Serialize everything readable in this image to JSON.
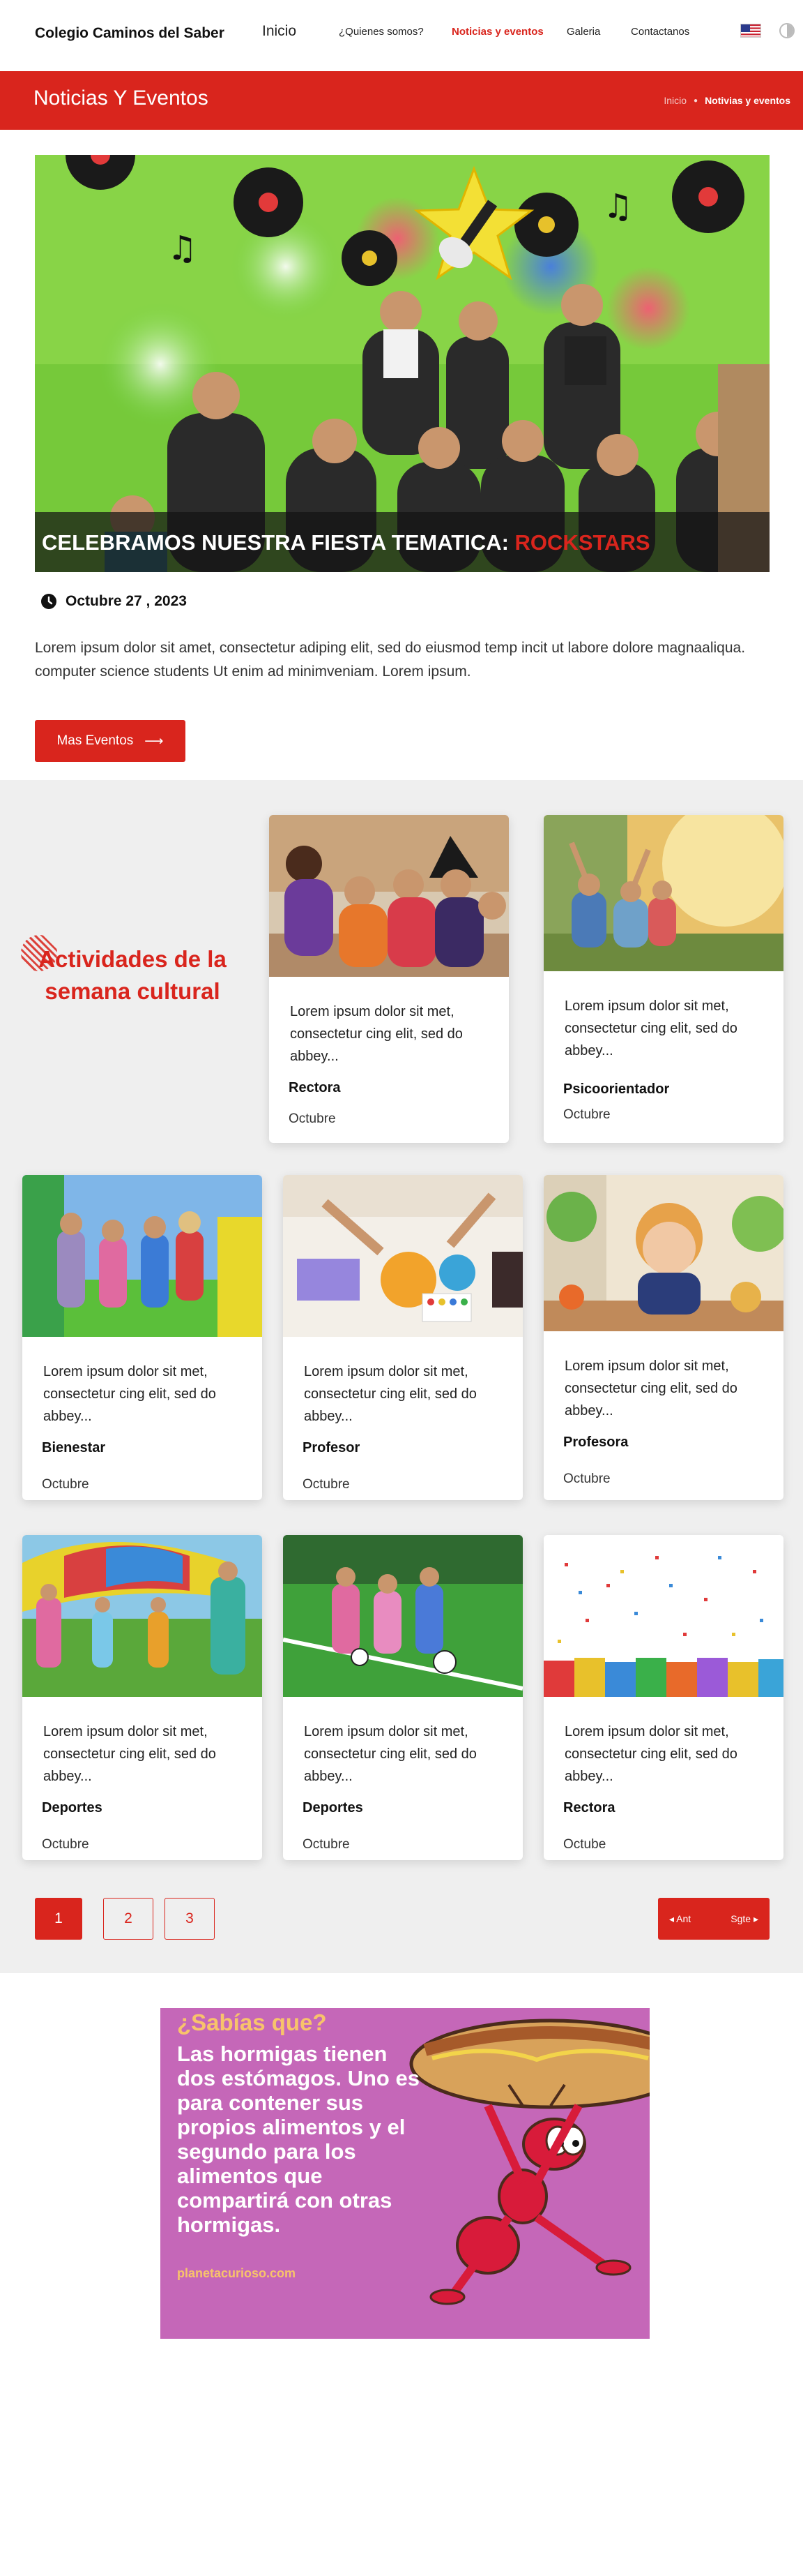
{
  "header": {
    "logo": "Colegio Caminos del Saber",
    "nav": {
      "home": "Inicio",
      "about": "¿Quienes somos?",
      "news": "Noticias y eventos",
      "gallery": "Galeria",
      "contact": "Contactanos"
    }
  },
  "banner": {
    "title": "Noticias Y Eventos",
    "breadcrumb_home": "Inicio",
    "breadcrumb_current": "Notivias y eventos"
  },
  "hero": {
    "caption_main": "CELEBRAMOS NUESTRA FIESTA TEMATICA: ",
    "caption_highlight": "ROCKSTARS"
  },
  "post": {
    "date": "Octubre 27 , 2023",
    "intro": "Lorem ipsum dolor sit amet, consectetur adiping elit, sed do eiusmod temp incit ut labore dolore magnaaliqua. computer science students Ut enim ad minimveniam. Lorem ipsum.",
    "more_label": "Mas Eventos"
  },
  "activities": {
    "title": "Actividades de la semana cultural",
    "cards": [
      {
        "text": "Lorem ipsum dolor sit met, consectetur cing elit, sed do abbey...",
        "role": "Rectora",
        "date": "Octubre"
      },
      {
        "text": "Lorem ipsum dolor sit met, consectetur cing elit, sed do abbey...",
        "role": "Psicoorientador",
        "date": "Octubre"
      },
      {
        "text": "Lorem ipsum dolor sit met, consectetur cing elit, sed do abbey...",
        "role": "Bienestar",
        "date": "Octubre"
      },
      {
        "text": "Lorem ipsum dolor sit met, consectetur cing elit, sed do abbey...",
        "role": "Profesor",
        "date": "Octubre"
      },
      {
        "text": "Lorem ipsum dolor sit met, consectetur cing elit, sed do abbey...",
        "role": "Profesora",
        "date": "Octubre"
      },
      {
        "text": "Lorem ipsum dolor sit met, consectetur cing elit, sed do abbey...",
        "role": "Deportes",
        "date": "Octubre"
      },
      {
        "text": "Lorem ipsum dolor sit met, consectetur cing elit, sed do abbey...",
        "role": "Deportes",
        "date": "Octubre"
      },
      {
        "text": "Lorem ipsum dolor sit met, consectetur cing elit, sed do abbey...",
        "role": "Rectora",
        "date": "Octube"
      }
    ]
  },
  "pagination": {
    "pages": [
      "1",
      "2",
      "3"
    ],
    "prev": "Ant",
    "next": "Sgte"
  },
  "fact": {
    "title": "¿Sabías que?",
    "body": "Las hormigas tienen dos estómagos. Uno  es para contener sus propios alimentos y el segundo para los alimentos que compartirá  con otras hormigas.",
    "source": "planetacurioso.com"
  },
  "colors": {
    "accent": "#d9251d",
    "section_bg": "#efefef",
    "fact_bg": "#c567b8",
    "fact_title": "#f8c36b"
  },
  "icons": [
    "flag-us-icon",
    "theme-toggle-icon",
    "clock-icon",
    "arrow-right-icon",
    "chevron-left-icon",
    "chevron-right-icon"
  ]
}
